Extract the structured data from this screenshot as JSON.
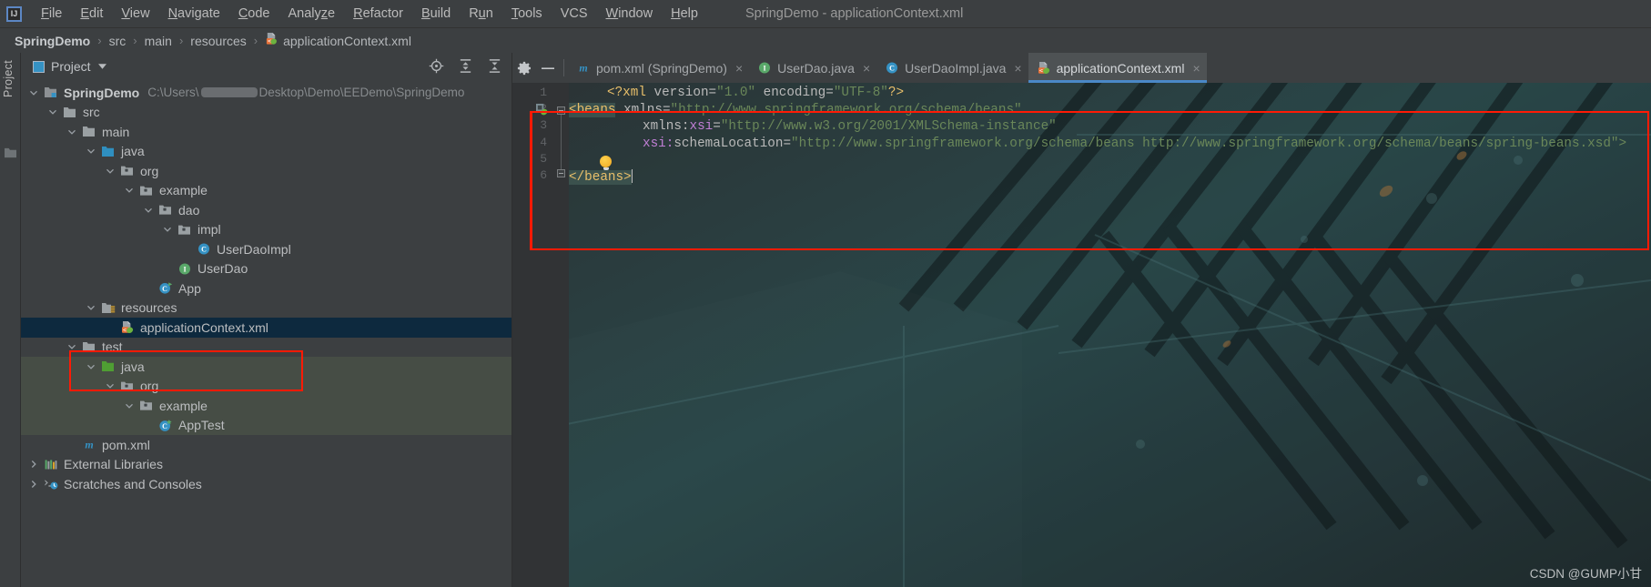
{
  "window": {
    "title": "SpringDemo - applicationContext.xml",
    "logo_text": "IJ"
  },
  "menubar": {
    "items": [
      {
        "label": "File",
        "mnemonic": "F"
      },
      {
        "label": "Edit",
        "mnemonic": "E"
      },
      {
        "label": "View",
        "mnemonic": "V"
      },
      {
        "label": "Navigate",
        "mnemonic": "N"
      },
      {
        "label": "Code",
        "mnemonic": "C"
      },
      {
        "label": "Analyze",
        "mnemonic": "z"
      },
      {
        "label": "Refactor",
        "mnemonic": "R"
      },
      {
        "label": "Build",
        "mnemonic": "B"
      },
      {
        "label": "Run",
        "mnemonic": "u"
      },
      {
        "label": "Tools",
        "mnemonic": "T"
      },
      {
        "label": "VCS",
        "mnemonic": ""
      },
      {
        "label": "Window",
        "mnemonic": "W"
      },
      {
        "label": "Help",
        "mnemonic": "H"
      }
    ]
  },
  "breadcrumb": {
    "items": [
      "SpringDemo",
      "src",
      "main",
      "resources",
      "applicationContext.xml"
    ],
    "separator": "›",
    "last_icon": "spring-xml-icon"
  },
  "toolstrip": {
    "project_label": "Project",
    "folder_icon": "folder-icon"
  },
  "project_panel": {
    "header": {
      "title": "Project",
      "caret_icon": "chevron-down-icon",
      "tools": [
        "locate-target-icon",
        "expand-all-icon",
        "collapse-all-icon",
        "gear-icon",
        "hide-icon"
      ]
    },
    "tree": [
      {
        "label": "SpringDemo",
        "path_prefix": "C:\\Users\\",
        "path_suffix": "Desktop\\Demo\\EEDemo\\SpringDemo",
        "icon": "module-folder-icon",
        "arrow": "expanded",
        "depth": 0,
        "bold": true
      },
      {
        "label": "src",
        "icon": "folder-icon",
        "arrow": "expanded",
        "depth": 1
      },
      {
        "label": "main",
        "icon": "folder-icon",
        "arrow": "expanded",
        "depth": 2
      },
      {
        "label": "java",
        "icon": "source-folder-icon",
        "arrow": "expanded",
        "depth": 3
      },
      {
        "label": "org",
        "icon": "package-icon",
        "arrow": "expanded",
        "depth": 4
      },
      {
        "label": "example",
        "icon": "package-icon",
        "arrow": "expanded",
        "depth": 5
      },
      {
        "label": "dao",
        "icon": "package-icon",
        "arrow": "expanded",
        "depth": 6
      },
      {
        "label": "impl",
        "icon": "package-icon",
        "arrow": "expanded",
        "depth": 7
      },
      {
        "label": "UserDaoImpl",
        "icon": "java-class-icon",
        "arrow": "none",
        "depth": 8
      },
      {
        "label": "UserDao",
        "icon": "java-interface-icon",
        "arrow": "none",
        "depth": 7
      },
      {
        "label": "App",
        "icon": "java-runnable-class-icon",
        "arrow": "none",
        "depth": 6
      },
      {
        "label": "resources",
        "icon": "resource-folder-icon",
        "arrow": "expanded",
        "depth": 3
      },
      {
        "label": "applicationContext.xml",
        "icon": "spring-xml-icon",
        "arrow": "none",
        "depth": 4,
        "selected": true
      },
      {
        "label": "test",
        "icon": "folder-icon",
        "arrow": "expanded",
        "depth": 2
      },
      {
        "label": "java",
        "icon": "test-source-folder-icon",
        "arrow": "expanded",
        "depth": 3
      },
      {
        "label": "org",
        "icon": "package-icon",
        "arrow": "expanded",
        "depth": 4
      },
      {
        "label": "example",
        "icon": "package-icon",
        "arrow": "expanded",
        "depth": 5
      },
      {
        "label": "AppTest",
        "icon": "java-test-class-icon",
        "arrow": "none",
        "depth": 6
      },
      {
        "label": "pom.xml",
        "icon": "maven-icon",
        "arrow": "none",
        "depth": 2
      },
      {
        "label": "External Libraries",
        "icon": "libraries-icon",
        "arrow": "collapsed",
        "depth": 0
      },
      {
        "label": "Scratches and Consoles",
        "icon": "scratches-icon",
        "arrow": "collapsed",
        "depth": 0
      }
    ]
  },
  "editor": {
    "tabs": [
      {
        "label": "pom.xml (SpringDemo)",
        "icon": "maven-icon",
        "active": false,
        "closable": true
      },
      {
        "label": "UserDao.java",
        "icon": "java-interface-icon",
        "active": false,
        "closable": true
      },
      {
        "label": "UserDaoImpl.java",
        "icon": "java-class-icon",
        "active": false,
        "closable": true
      },
      {
        "label": "applicationContext.xml",
        "icon": "spring-xml-icon",
        "active": true,
        "closable": true
      }
    ],
    "close_glyph": "×",
    "line_numbers": [
      "1",
      "2",
      "3",
      "4",
      "5",
      "6"
    ],
    "code": {
      "line1_decl_open": "<?xml",
      "line1_attr_version": " version=",
      "line1_val_version": "\"1.0\"",
      "line1_attr_encoding": " encoding=",
      "line1_val_encoding": "\"UTF-8\"",
      "line1_decl_close": "?>",
      "line2_tag": "<beans",
      "line2_attr": " xmlns=",
      "line2_val": "\"http://www.springframework.org/schema/beans\"",
      "line3_attr_ns": "xmlns:",
      "line3_attr_local": "xsi",
      "line3_eq": "=",
      "line3_val": "\"http://www.w3.org/2001/XMLSchema-instance\"",
      "line4_attr_ns": "xsi:",
      "line4_attr_local": "schemaLocation",
      "line4_eq": "=",
      "line4_val": "\"http://www.springframework.org/schema/beans http://www.springframework.org/schema/beans/spring-beans.xsd\">",
      "line6_close_tag": "</beans>"
    },
    "intention_bulb": "lightbulb-icon",
    "spring_gutter_icon": "spring-bean-gutter-icon",
    "annotation_box_color": "#ff1a05"
  },
  "watermark": {
    "text": "CSDN @GUMP小甘"
  }
}
